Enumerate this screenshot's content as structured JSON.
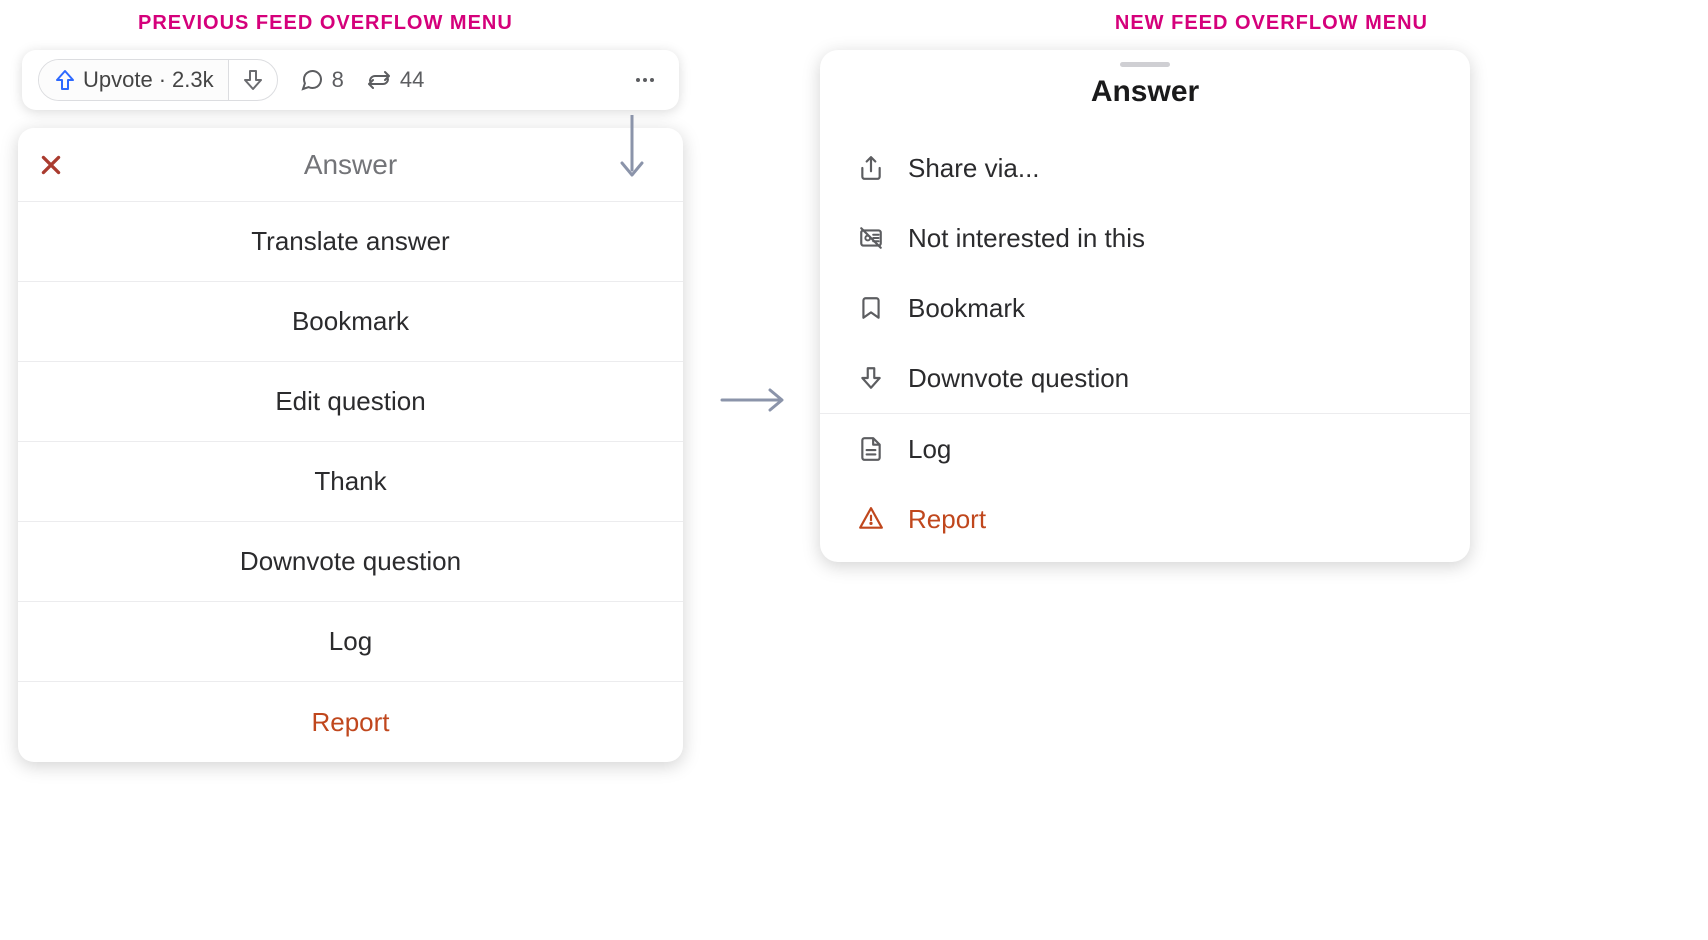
{
  "labels": {
    "previous": "PREVIOUS FEED OVERFLOW MENU",
    "new": "NEW FEED OVERFLOW MENU"
  },
  "action_bar": {
    "upvote_label": "Upvote",
    "upvote_count": "2.3k",
    "comments": "8",
    "shares": "44"
  },
  "previous_menu": {
    "title": "Answer",
    "items": [
      {
        "label": "Translate answer"
      },
      {
        "label": "Bookmark"
      },
      {
        "label": "Edit question"
      },
      {
        "label": "Thank"
      },
      {
        "label": "Downvote question"
      },
      {
        "label": "Log"
      },
      {
        "label": "Report"
      }
    ]
  },
  "new_menu": {
    "title": "Answer",
    "items": [
      {
        "label": "Share via..."
      },
      {
        "label": "Not interested in this"
      },
      {
        "label": "Bookmark"
      },
      {
        "label": "Downvote question"
      },
      {
        "label": "Log"
      },
      {
        "label": "Report"
      }
    ]
  },
  "colors": {
    "accent_pink": "#d5007b",
    "quora_blue": "#2e69ff",
    "danger": "#c0471d",
    "border": "#ececee",
    "muted": "#737478"
  }
}
